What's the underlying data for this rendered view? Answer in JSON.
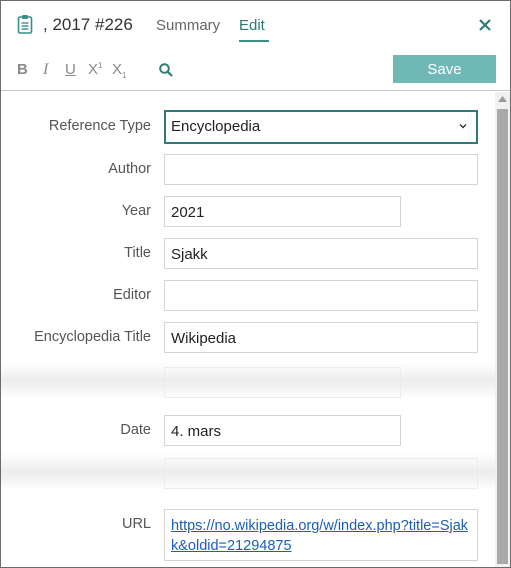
{
  "header": {
    "title": ", 2017 #226",
    "tabs": {
      "summary": "Summary",
      "edit": "Edit"
    },
    "close_icon": "close-icon",
    "clipboard_icon": "clipboard-icon"
  },
  "toolbar": {
    "bold": "B",
    "italic": "I",
    "underline": "U",
    "superscript": "X",
    "superscript_mark": "1",
    "subscript": "X",
    "subscript_mark": "1",
    "search_icon": "search-icon",
    "save_label": "Save"
  },
  "form": {
    "reference_type": {
      "label": "Reference Type",
      "value": "Encyclopedia"
    },
    "author": {
      "label": "Author",
      "value": ""
    },
    "year": {
      "label": "Year",
      "value": "2021"
    },
    "title": {
      "label": "Title",
      "value": "Sjakk"
    },
    "editor": {
      "label": "Editor",
      "value": ""
    },
    "encyclopedia_title": {
      "label": "Encyclopedia Title",
      "value": "Wikipedia"
    },
    "date": {
      "label": "Date",
      "value": "4. mars"
    },
    "url": {
      "label": "URL",
      "value": "https://no.wikipedia.org/w/index.php?title=Sjakk&oldid=21294875"
    }
  },
  "colors": {
    "accent": "#2f7d7a",
    "save_button": "#6fb8b5",
    "link": "#1a5fb4"
  }
}
